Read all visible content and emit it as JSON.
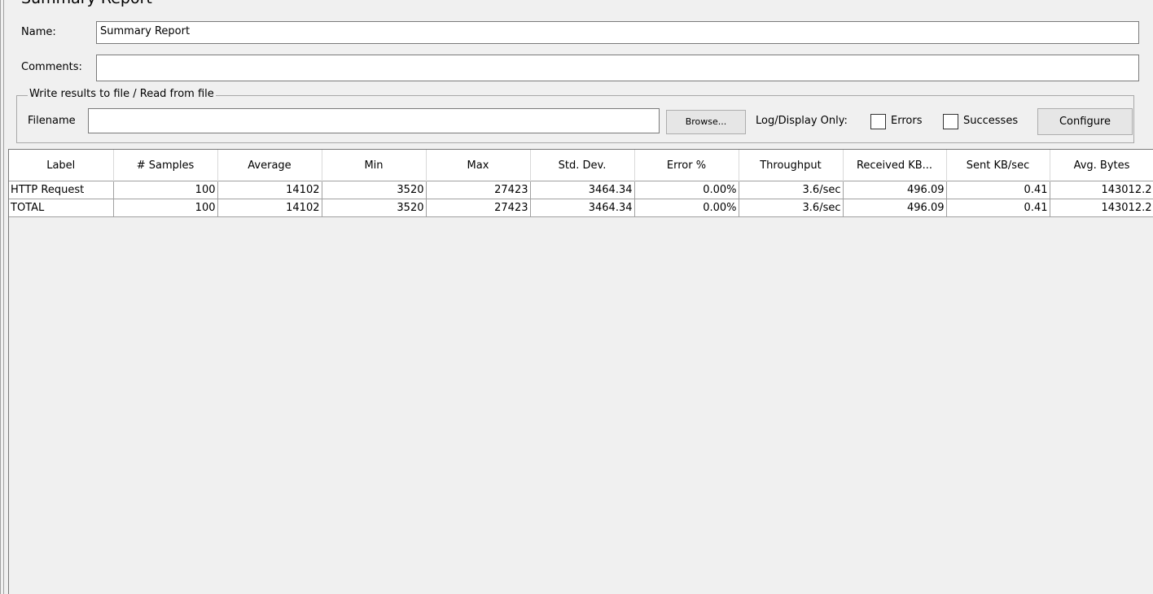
{
  "panel": {
    "title": "Summary Report",
    "name_label": "Name:",
    "name_value": "Summary Report",
    "comments_label": "Comments:",
    "comments_value": ""
  },
  "file_group": {
    "legend": "Write results to file / Read from file",
    "filename_label": "Filename",
    "filename_value": "",
    "browse_label": "Browse...",
    "log_display_label": "Log/Display Only:",
    "errors_label": "Errors",
    "errors_checked": false,
    "successes_label": "Successes",
    "successes_checked": false,
    "configure_label": "Configure"
  },
  "table": {
    "columns": [
      "Label",
      "# Samples",
      "Average",
      "Min",
      "Max",
      "Std. Dev.",
      "Error %",
      "Throughput",
      "Received KB...",
      "Sent KB/sec",
      "Avg. Bytes"
    ],
    "rows": [
      [
        "HTTP Request",
        "100",
        "14102",
        "3520",
        "27423",
        "3464.34",
        "0.00%",
        "3.6/sec",
        "496.09",
        "0.41",
        "143012.2"
      ],
      [
        "TOTAL",
        "100",
        "14102",
        "3520",
        "27423",
        "3464.34",
        "0.00%",
        "3.6/sec",
        "496.09",
        "0.41",
        "143012.2"
      ]
    ]
  }
}
